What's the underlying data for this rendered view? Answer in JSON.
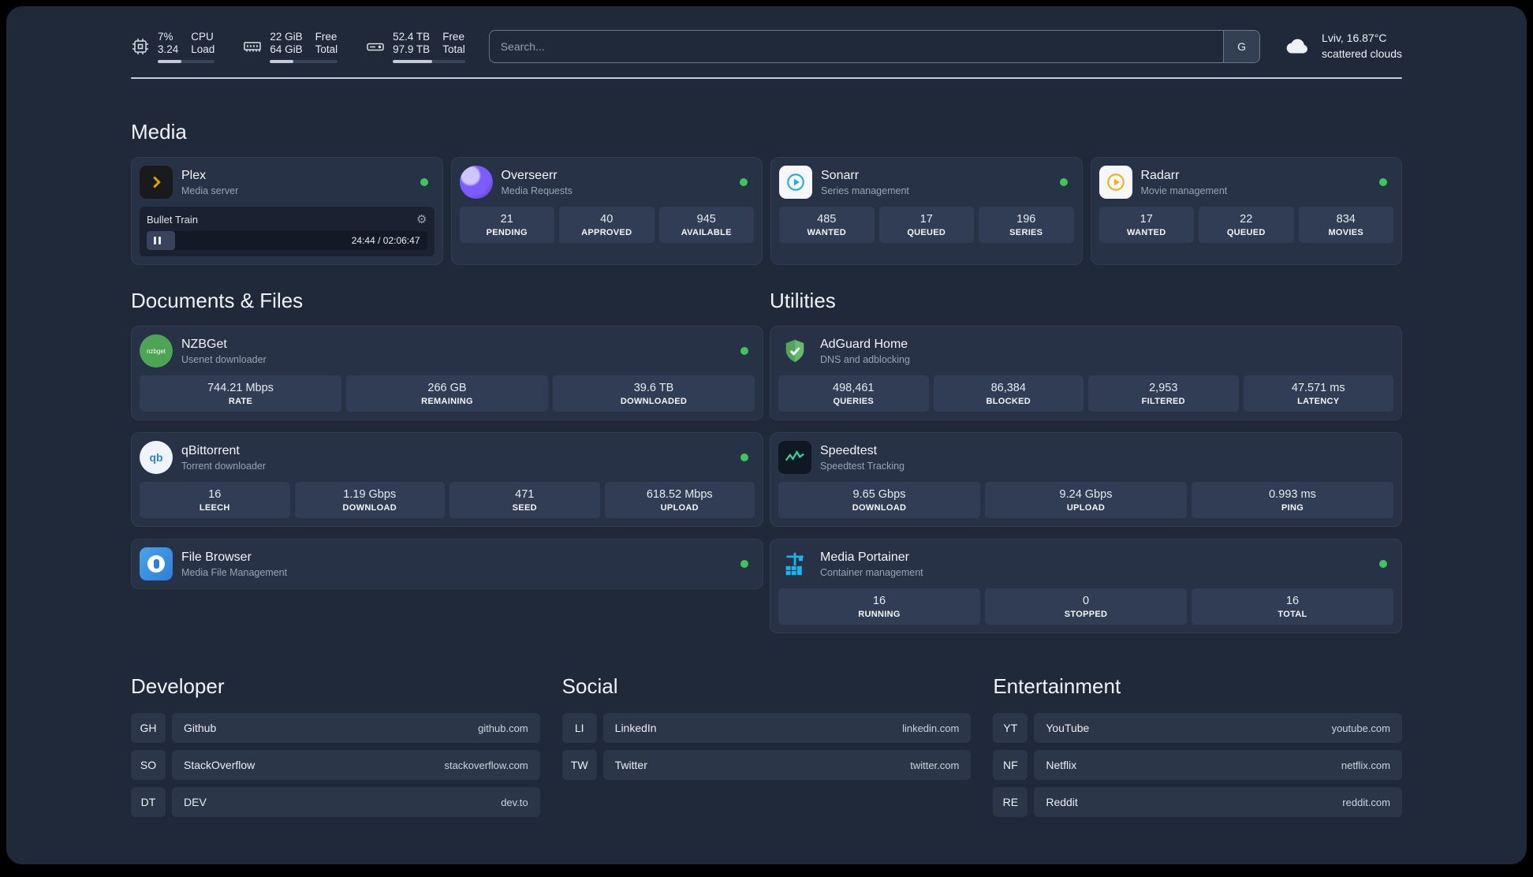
{
  "colors": {
    "bg": "#1f2939",
    "card": "#273247",
    "tile": "#313d54",
    "row": "#2b3648",
    "player": "#1a2231",
    "green": "#3fc55f",
    "divider": "#c9cfd7"
  },
  "icons": {
    "gear": "⚙",
    "nzbget_label": "nzbget",
    "qb_label": "qb"
  },
  "topbar": {
    "metrics": [
      {
        "value1": "7%",
        "label1": "CPU",
        "value2": "3.24",
        "label2": "Load",
        "bar_percent": 42
      },
      {
        "value1": "22 GiB",
        "label1": "Free",
        "value2": "64 GiB",
        "label2": "Total",
        "bar_percent": 34
      },
      {
        "value1": "52.4 TB",
        "label1": "Free",
        "value2": "97.9 TB",
        "label2": "Total",
        "bar_percent": 54
      }
    ],
    "search": {
      "placeholder": "Search...",
      "button": "G"
    },
    "weather": {
      "location": "Lviv, 16.87°C",
      "condition": "scattered clouds"
    }
  },
  "sections": {
    "media": "Media",
    "documents": "Documents & Files",
    "utilities": "Utilities",
    "developer": "Developer",
    "social": "Social",
    "entertainment": "Entertainment"
  },
  "apps": {
    "plex": {
      "name": "Plex",
      "desc": "Media server",
      "player": {
        "title": "Bullet Train",
        "time": "24:44 / 02:06:47",
        "progress": 10
      }
    },
    "overseerr": {
      "name": "Overseerr",
      "desc": "Media Requests",
      "stats": [
        {
          "value": "21",
          "label": "PENDING"
        },
        {
          "value": "40",
          "label": "APPROVED"
        },
        {
          "value": "945",
          "label": "AVAILABLE"
        }
      ]
    },
    "sonarr": {
      "name": "Sonarr",
      "desc": "Series management",
      "stats": [
        {
          "value": "485",
          "label": "WANTED"
        },
        {
          "value": "17",
          "label": "QUEUED"
        },
        {
          "value": "196",
          "label": "SERIES"
        }
      ]
    },
    "radarr": {
      "name": "Radarr",
      "desc": "Movie management",
      "stats": [
        {
          "value": "17",
          "label": "WANTED"
        },
        {
          "value": "22",
          "label": "QUEUED"
        },
        {
          "value": "834",
          "label": "MOVIES"
        }
      ]
    },
    "nzbget": {
      "name": "NZBGet",
      "desc": "Usenet downloader",
      "stats": [
        {
          "value": "744.21 Mbps",
          "label": "RATE"
        },
        {
          "value": "266 GB",
          "label": "REMAINING"
        },
        {
          "value": "39.6 TB",
          "label": "DOWNLOADED"
        }
      ]
    },
    "qbittorrent": {
      "name": "qBittorrent",
      "desc": "Torrent downloader",
      "stats": [
        {
          "value": "16",
          "label": "LEECH"
        },
        {
          "value": "1.19 Gbps",
          "label": "DOWNLOAD"
        },
        {
          "value": "471",
          "label": "SEED"
        },
        {
          "value": "618.52 Mbps",
          "label": "UPLOAD"
        }
      ]
    },
    "filebrowser": {
      "name": "File Browser",
      "desc": "Media File Management"
    },
    "adguard": {
      "name": "AdGuard Home",
      "desc": "DNS and adblocking",
      "stats": [
        {
          "value": "498,461",
          "label": "QUERIES"
        },
        {
          "value": "86,384",
          "label": "BLOCKED"
        },
        {
          "value": "2,953",
          "label": "FILTERED"
        },
        {
          "value": "47.571 ms",
          "label": "LATENCY"
        }
      ]
    },
    "speedtest": {
      "name": "Speedtest",
      "desc": "Speedtest Tracking",
      "stats": [
        {
          "value": "9.65 Gbps",
          "label": "DOWNLOAD"
        },
        {
          "value": "9.24 Gbps",
          "label": "UPLOAD"
        },
        {
          "value": "0.993 ms",
          "label": "PING"
        }
      ]
    },
    "portainer": {
      "name": "Media Portainer",
      "desc": "Container management",
      "stats": [
        {
          "value": "16",
          "label": "RUNNING"
        },
        {
          "value": "0",
          "label": "STOPPED"
        },
        {
          "value": "16",
          "label": "TOTAL"
        }
      ]
    }
  },
  "bookmarks": {
    "developer": [
      {
        "abbr": "GH",
        "name": "Github",
        "url": "github.com"
      },
      {
        "abbr": "SO",
        "name": "StackOverflow",
        "url": "stackoverflow.com"
      },
      {
        "abbr": "DT",
        "name": "DEV",
        "url": "dev.to"
      }
    ],
    "social": [
      {
        "abbr": "LI",
        "name": "LinkedIn",
        "url": "linkedin.com"
      },
      {
        "abbr": "TW",
        "name": "Twitter",
        "url": "twitter.com"
      }
    ],
    "entertainment": [
      {
        "abbr": "YT",
        "name": "YouTube",
        "url": "youtube.com"
      },
      {
        "abbr": "NF",
        "name": "Netflix",
        "url": "netflix.com"
      },
      {
        "abbr": "RE",
        "name": "Reddit",
        "url": "reddit.com"
      }
    ]
  }
}
